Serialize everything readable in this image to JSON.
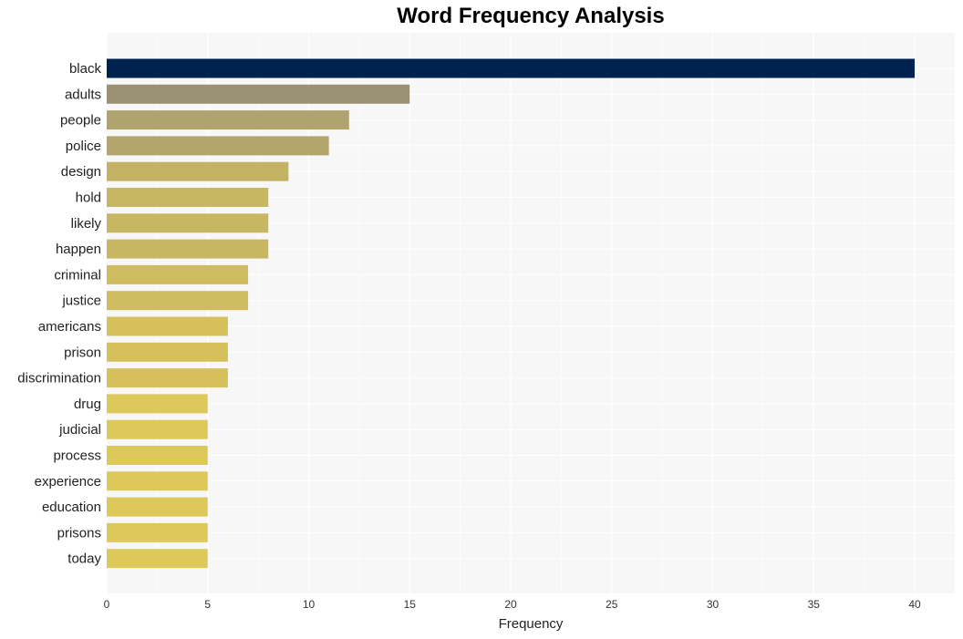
{
  "chart_data": {
    "type": "bar",
    "orientation": "horizontal",
    "title": "Word Frequency Analysis",
    "xlabel": "Frequency",
    "ylabel": "",
    "xlim": [
      0,
      42
    ],
    "xticks": [
      0,
      5,
      10,
      15,
      20,
      25,
      30,
      35,
      40
    ],
    "grid": true,
    "categories": [
      "black",
      "adults",
      "people",
      "police",
      "design",
      "hold",
      "likely",
      "happen",
      "criminal",
      "justice",
      "americans",
      "prison",
      "discrimination",
      "drug",
      "judicial",
      "process",
      "experience",
      "education",
      "prisons",
      "today"
    ],
    "values": [
      40,
      15,
      12,
      11,
      9,
      8,
      8,
      8,
      7,
      7,
      6,
      6,
      6,
      5,
      5,
      5,
      5,
      5,
      5,
      5
    ],
    "colors": [
      "#00224e",
      "#9b9274",
      "#b0a46e",
      "#b3a56c",
      "#c4b365",
      "#c8b762",
      "#c8b762",
      "#c8b762",
      "#cfbc60",
      "#cfbc60",
      "#d5c05c",
      "#d5c05c",
      "#d5c05c",
      "#ddc85a",
      "#ddc85a",
      "#ddc85a",
      "#ddc85a",
      "#ddc85a",
      "#ddc85a",
      "#ddc85a"
    ],
    "plot_background": "#f7f7f7"
  }
}
